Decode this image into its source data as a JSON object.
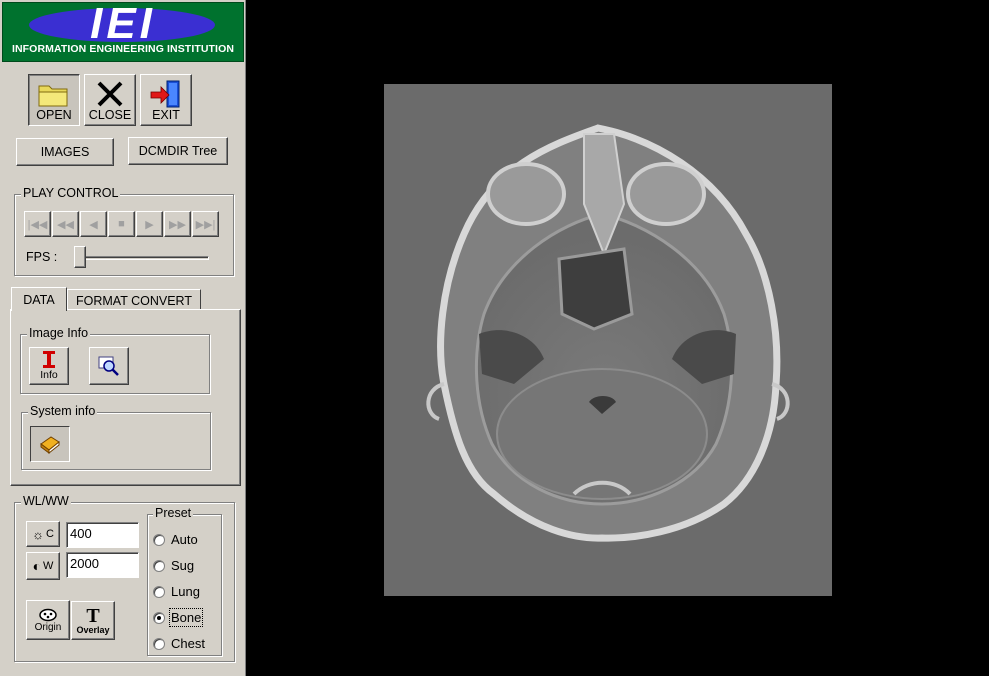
{
  "logo": {
    "letters": "IEI",
    "caption": "INFORMATION ENGINEERING INSTITUTION"
  },
  "toolbar": {
    "open": {
      "label": "OPEN",
      "icon": "folder-icon"
    },
    "close": {
      "label": "CLOSE",
      "icon": "close-x-icon"
    },
    "exit": {
      "label": "EXIT",
      "icon": "exit-door-icon"
    }
  },
  "buttons": {
    "images": "IMAGES",
    "dcmdir": "DCMDIR Tree"
  },
  "play_control": {
    "title": "PLAY CONTROL",
    "buttons": [
      "first",
      "fast-rewind",
      "previous",
      "stop",
      "play",
      "fast-forward",
      "last"
    ],
    "fps_label": "FPS :",
    "fps_level": 0
  },
  "tabs": [
    {
      "label": "DATA",
      "active": true
    },
    {
      "label": "FORMAT CONVERT",
      "active": false
    }
  ],
  "image_info": {
    "title": "Image Info",
    "info_label": "Info"
  },
  "system_info": {
    "title": "System info"
  },
  "wlww": {
    "title": "WL/WW",
    "c_label": "C",
    "c_value": "400",
    "w_label": "W",
    "w_value": "2000",
    "origin_label": "Origin",
    "overlay_label": "Overlay"
  },
  "preset": {
    "title": "Preset",
    "options": [
      "Auto",
      "Sug",
      "Lung",
      "Bone",
      "Chest"
    ],
    "selected": "Bone"
  },
  "colors": {
    "logo_green": "#00722e",
    "logo_blue": "#3a2fd2",
    "panel_gray": "#d4d0c8",
    "viewer_bg": "#000000"
  }
}
